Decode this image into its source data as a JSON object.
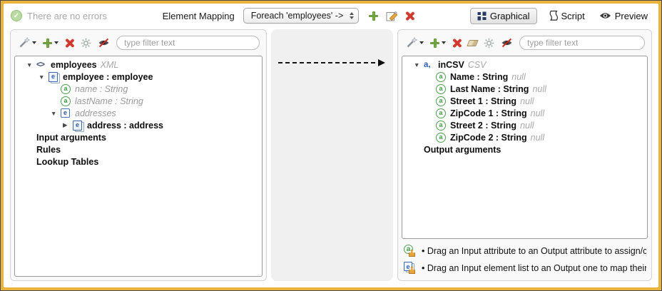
{
  "header": {
    "status": {
      "icon": "check-circle",
      "text": "There are no errors"
    },
    "mapping": {
      "label": "Element Mapping",
      "selected": "Foreach 'employees' ->"
    },
    "actions": [
      "add-mapping",
      "edit-mapping",
      "delete-mapping"
    ],
    "views": {
      "graphical": "Graphical",
      "script": "Script",
      "preview": "Preview"
    },
    "active_view": "Graphical"
  },
  "colors": {
    "frame_border": "#e9b437",
    "add_green": "#79b144",
    "delete_red": "#d23a2e",
    "attr_green": "#3f9c3f",
    "element_blue": "#2f5fae"
  },
  "panels": {
    "input": {
      "toolbar_icons": [
        "wand",
        "add",
        "delete",
        "settings",
        "hide-attributes"
      ],
      "filter_placeholder": "type filter text",
      "tree": [
        {
          "indent": "i0",
          "arrow": "down",
          "icon": "xml-tag",
          "label": "employees",
          "style": "bold",
          "suffix": "XML"
        },
        {
          "indent": "i1",
          "arrow": "down",
          "icon": "element-list",
          "label": "employee : employee",
          "style": "bold",
          "suffix": ""
        },
        {
          "indent": "i2",
          "arrow": "blank",
          "icon": "attribute",
          "label": "name : String",
          "style": "muted",
          "suffix": ""
        },
        {
          "indent": "i2",
          "arrow": "blank",
          "icon": "attribute",
          "label": "lastName : String",
          "style": "muted",
          "suffix": ""
        },
        {
          "indent": "i2",
          "arrow": "down",
          "icon": "element",
          "label": "addresses",
          "style": "muted",
          "suffix": ""
        },
        {
          "indent": "i3",
          "arrow": "right",
          "icon": "element-list",
          "label": "address : address",
          "style": "bold",
          "suffix": ""
        },
        {
          "indent": "i0",
          "arrow": "blank",
          "icon": "none",
          "label": "Input arguments",
          "style": "bold",
          "suffix": ""
        },
        {
          "indent": "i0",
          "arrow": "blank",
          "icon": "none",
          "label": "Rules",
          "style": "bold",
          "suffix": ""
        },
        {
          "indent": "i0",
          "arrow": "blank",
          "icon": "none",
          "label": "Lookup Tables",
          "style": "bold",
          "suffix": ""
        }
      ]
    },
    "canvas": {
      "mapping_arrow": "foreach employees -> inCSV"
    },
    "output": {
      "toolbar_icons": [
        "wand",
        "add",
        "delete",
        "erase",
        "settings",
        "hide-attributes"
      ],
      "filter_placeholder": "type filter text",
      "tree": [
        {
          "indent": "i0",
          "arrow": "down",
          "icon": "csv",
          "label": "inCSV",
          "style": "bold",
          "suffix": "CSV"
        },
        {
          "indent": "i1",
          "arrow": "blank",
          "icon": "attribute",
          "label": "Name : String",
          "style": "bold",
          "suffix": "null"
        },
        {
          "indent": "i1",
          "arrow": "blank",
          "icon": "attribute",
          "label": "Last Name : String",
          "style": "bold",
          "suffix": "null"
        },
        {
          "indent": "i1",
          "arrow": "blank",
          "icon": "attribute",
          "label": "Street 1 : String",
          "style": "bold",
          "suffix": "null"
        },
        {
          "indent": "i1",
          "arrow": "blank",
          "icon": "attribute",
          "label": "ZipCode 1 : String",
          "style": "bold",
          "suffix": "null"
        },
        {
          "indent": "i1",
          "arrow": "blank",
          "icon": "attribute",
          "label": "Street 2 : String",
          "style": "bold",
          "suffix": "null"
        },
        {
          "indent": "i1",
          "arrow": "blank",
          "icon": "attribute",
          "label": "ZipCode 2 : String",
          "style": "bold",
          "suffix": "null"
        },
        {
          "indent": "i0",
          "arrow": "blank",
          "icon": "none",
          "label": "Output arguments",
          "style": "bold",
          "suffix": ""
        }
      ],
      "hints": [
        {
          "icon": "attribute-drag",
          "text": "• Drag an Input attribute to an Output attribute to assign/co"
        },
        {
          "icon": "element-drag",
          "text": "• Drag an Input element list to an Output one to map their a"
        }
      ]
    }
  }
}
